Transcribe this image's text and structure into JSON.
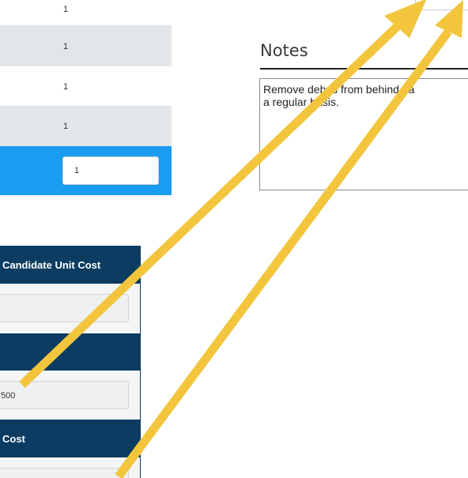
{
  "quantity_rows": [
    "1",
    "1",
    "1",
    "1"
  ],
  "selected_quantity_value": "1",
  "notes": {
    "title": "Notes",
    "text": "Remove debris from behind ba\na regular basis."
  },
  "cost_panel": {
    "header_1": "Candidate Unit Cost",
    "field_1_value": "",
    "header_2": "",
    "field_2_value": "500",
    "header_3": "Cost",
    "field_3_value": ""
  },
  "colors": {
    "header_navy": "#0c3c61",
    "selected_row_blue": "#1a9cf0",
    "annotation_arrow": "#f2c53d"
  }
}
